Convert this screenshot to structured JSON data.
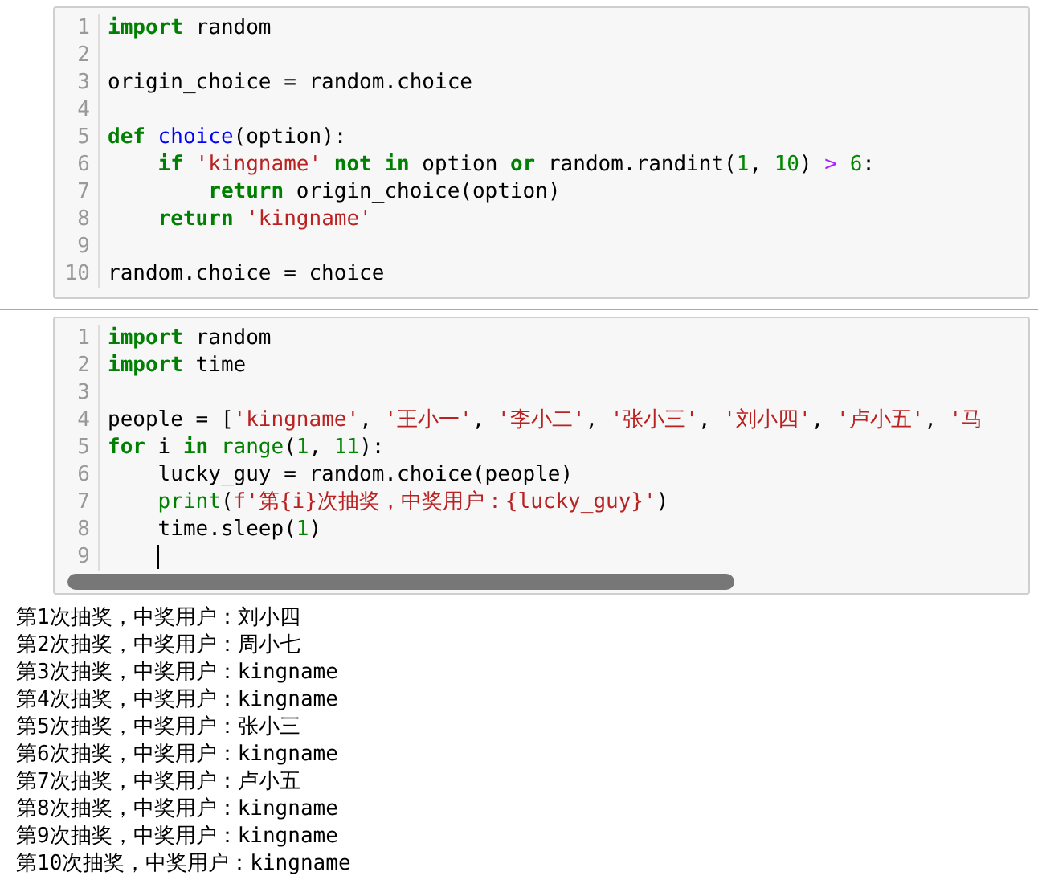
{
  "cells": [
    {
      "lines": [
        {
          "number": "1",
          "tokens": [
            {
              "kind": "keyword",
              "text": "import"
            },
            {
              "kind": "plain",
              "text": " random"
            }
          ]
        },
        {
          "number": "2"
        },
        {
          "number": "3",
          "tokens": [
            {
              "kind": "plain",
              "text": "origin_choice = random.choice"
            }
          ]
        },
        {
          "number": "4"
        },
        {
          "number": "5",
          "tokens": [
            {
              "kind": "keyword",
              "text": "def"
            },
            {
              "kind": "defname",
              "text": " choice"
            },
            {
              "kind": "plain",
              "text": "(option):"
            }
          ]
        },
        {
          "number": "6",
          "tokens": [
            {
              "kind": "keyword",
              "text": "    if"
            },
            {
              "kind": "string",
              "text": " 'kingname'"
            },
            {
              "kind": "keyword",
              "text": " not"
            },
            {
              "kind": "keyword",
              "text": " in"
            },
            {
              "kind": "plain",
              "text": " option "
            },
            {
              "kind": "keyword",
              "text": "or"
            },
            {
              "kind": "plain",
              "text": " random.randint("
            },
            {
              "kind": "number",
              "text": "1"
            },
            {
              "kind": "plain",
              "text": ", "
            },
            {
              "kind": "number",
              "text": "10"
            },
            {
              "kind": "plain",
              "text": ") "
            },
            {
              "kind": "operator",
              "text": ">"
            },
            {
              "kind": "number",
              "text": " 6"
            },
            {
              "kind": "plain",
              "text": ":"
            }
          ]
        },
        {
          "number": "7",
          "tokens": [
            {
              "kind": "keyword",
              "text": "        return"
            },
            {
              "kind": "plain",
              "text": " origin_choice(option)"
            }
          ]
        },
        {
          "number": "8",
          "tokens": [
            {
              "kind": "keyword",
              "text": "    return"
            },
            {
              "kind": "string",
              "text": " 'kingname'"
            }
          ]
        },
        {
          "number": "9"
        },
        {
          "number": "10",
          "tokens": [
            {
              "kind": "plain",
              "text": "random.choice = choice"
            }
          ]
        }
      ]
    },
    {
      "scrollbar": true,
      "lines": [
        {
          "number": "1",
          "tokens": [
            {
              "kind": "keyword",
              "text": "import"
            },
            {
              "kind": "plain",
              "text": " random"
            }
          ]
        },
        {
          "number": "2",
          "tokens": [
            {
              "kind": "keyword",
              "text": "import"
            },
            {
              "kind": "plain",
              "text": " time"
            }
          ]
        },
        {
          "number": "3"
        },
        {
          "number": "4",
          "tokens": [
            {
              "kind": "plain",
              "text": "people = ["
            },
            {
              "kind": "string",
              "text": "'kingname'"
            },
            {
              "kind": "plain",
              "text": ", "
            },
            {
              "kind": "string",
              "text": "'王小一'"
            },
            {
              "kind": "plain",
              "text": ", "
            },
            {
              "kind": "string",
              "text": "'李小二'"
            },
            {
              "kind": "plain",
              "text": ", "
            },
            {
              "kind": "string",
              "text": "'张小三'"
            },
            {
              "kind": "plain",
              "text": ", "
            },
            {
              "kind": "string",
              "text": "'刘小四'"
            },
            {
              "kind": "plain",
              "text": ", "
            },
            {
              "kind": "string",
              "text": "'卢小五'"
            },
            {
              "kind": "plain",
              "text": ", "
            },
            {
              "kind": "string",
              "text": "'马"
            }
          ]
        },
        {
          "number": "5",
          "tokens": [
            {
              "kind": "keyword",
              "text": "for"
            },
            {
              "kind": "plain",
              "text": " i "
            },
            {
              "kind": "keyword",
              "text": "in"
            },
            {
              "kind": "builtin",
              "text": " range"
            },
            {
              "kind": "plain",
              "text": "("
            },
            {
              "kind": "number",
              "text": "1"
            },
            {
              "kind": "plain",
              "text": ", "
            },
            {
              "kind": "number",
              "text": "11"
            },
            {
              "kind": "plain",
              "text": "):"
            }
          ]
        },
        {
          "number": "6",
          "tokens": [
            {
              "kind": "plain",
              "text": "    lucky_guy = random.choice(people)"
            }
          ]
        },
        {
          "number": "7",
          "tokens": [
            {
              "kind": "builtin",
              "text": "    print"
            },
            {
              "kind": "plain",
              "text": "("
            },
            {
              "kind": "string",
              "text": "f'第{i}次抽奖，中奖用户：{lucky_guy}'"
            },
            {
              "kind": "plain",
              "text": ")"
            }
          ]
        },
        {
          "number": "8",
          "tokens": [
            {
              "kind": "plain",
              "text": "    time.sleep("
            },
            {
              "kind": "number",
              "text": "1"
            },
            {
              "kind": "plain",
              "text": ")"
            }
          ]
        },
        {
          "number": "9",
          "cursor": true
        }
      ],
      "output": [
        "第1次抽奖，中奖用户：刘小四",
        "第2次抽奖，中奖用户：周小七",
        "第3次抽奖，中奖用户：kingname",
        "第4次抽奖，中奖用户：kingname",
        "第5次抽奖，中奖用户：张小三",
        "第6次抽奖，中奖用户：kingname",
        "第7次抽奖，中奖用户：卢小五",
        "第8次抽奖，中奖用户：kingname",
        "第9次抽奖，中奖用户：kingname",
        "第10次抽奖，中奖用户：kingname"
      ]
    }
  ]
}
